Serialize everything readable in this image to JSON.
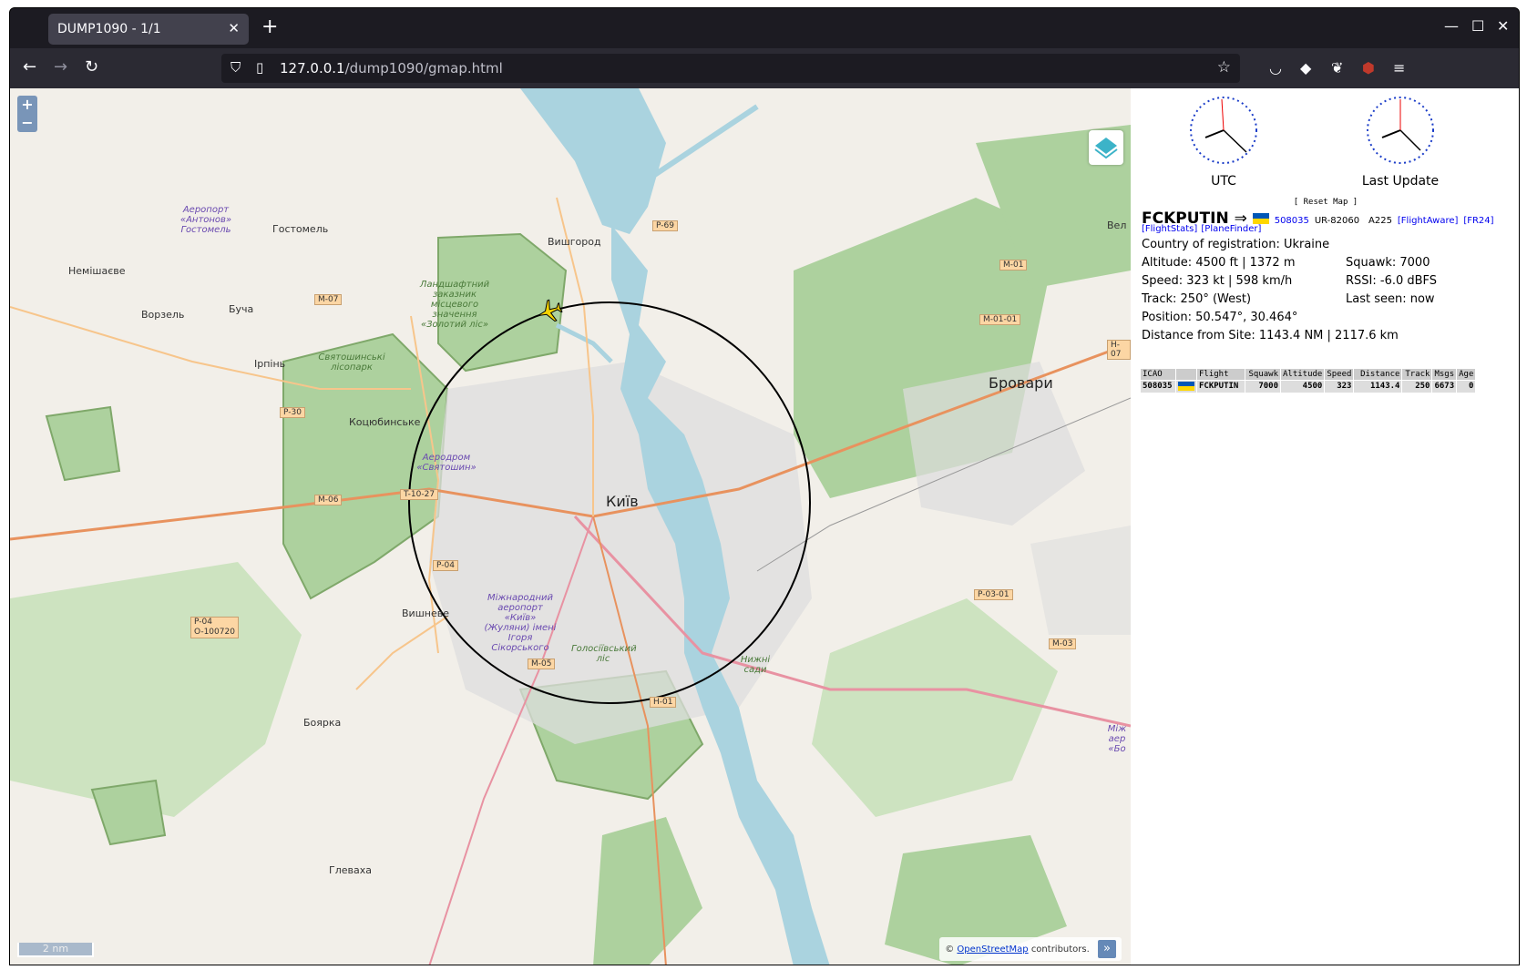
{
  "browser": {
    "tab_title": "DUMP1090 - 1/1",
    "tab_close": "✕",
    "new_tab": "+",
    "url_host": "127.0.0.1",
    "url_path": "/dump1090/gmap.html",
    "minimize": "—",
    "maximize": "☐",
    "close": "✕"
  },
  "map": {
    "zoom_in": "+",
    "zoom_out": "−",
    "scale_label": "2 nm",
    "attribution_prefix": "©",
    "attribution_link": "OpenStreetMap",
    "attribution_suffix": "contributors.",
    "attribution_expand": "»",
    "labels": {
      "kyiv": "Київ",
      "brovary": "Бровари",
      "vyshhorod": "Вишгород",
      "hostomel": "Гостомель",
      "nemishaeve": "Немішаєве",
      "vorzel": "Ворзель",
      "bucha": "Буча",
      "irpin": "Ірпінь",
      "kotsiubynske": "Коцюбинське",
      "vyshneve": "Вишневе",
      "boiarka": "Боярка",
      "hlevakha": "Глеваха",
      "vel": "Вел",
      "svyatoshynskyi": "Святошинські лісопарк",
      "zakaznyk": "Ландшафтний заказник місцевого значення «Золотий ліс»",
      "antonov": "Аеропорт «Антонов» Гостомель",
      "sviatoshyn": "Аеродром «Святошин»",
      "zhuliany": "Міжнародний аеропорт «Київ» (Жуляни) імені Ігоря Сікорського",
      "holosiivskyi": "Голосіївський ліс",
      "nyzhni": "Нижні сади",
      "mizh": "Між аер «Бо"
    },
    "roads": {
      "m07": "M-07",
      "p69": "P-69",
      "m01": "M-01",
      "m0101": "M-01-01",
      "h07": "H-07",
      "p30": "P-30",
      "m06": "M-06",
      "t1027": "T-10-27",
      "p04a": "P-04",
      "p04b": "P-04",
      "o100720": "O-100720",
      "m05": "M-05",
      "h01": "H-01",
      "p0301": "P-03-01",
      "m03": "M-03"
    }
  },
  "sidebar": {
    "clock_utc_label": "UTC",
    "clock_last_label": "Last Update",
    "reset_map": "[ Reset Map ]",
    "flight": "FCKPUTIN",
    "arrow": "⇒",
    "icao_link": "508035",
    "registration": "UR-82060",
    "type": "A225",
    "link_flightaware": "[FlightAware]",
    "link_fr24": "[FR24]",
    "link_flightstats": "[FlightStats]",
    "link_planefinder": "[PlaneFinder]",
    "country": "Country of registration: Ukraine",
    "altitude": "Altitude: 4500 ft | 1372 m",
    "squawk": "Squawk: 7000",
    "speed": "Speed: 323 kt | 598 km/h",
    "rssi": "RSSI: -6.0 dBFS",
    "track": "Track: 250° (West)",
    "last_seen": "Last seen: now",
    "position": "Position: 50.547°, 30.464°",
    "distance": "Distance from Site: 1143.4 NM | 2117.6 km",
    "table": {
      "headers": [
        "ICAO",
        "",
        "Flight",
        "Squawk",
        "Altitude",
        "Speed",
        "Distance",
        "Track",
        "Msgs",
        "Age"
      ],
      "rows": [
        [
          "508035",
          "",
          "FCKPUTIN",
          "7000",
          "4500",
          "323",
          "1143.4",
          "250",
          "6673",
          "0"
        ]
      ]
    }
  }
}
